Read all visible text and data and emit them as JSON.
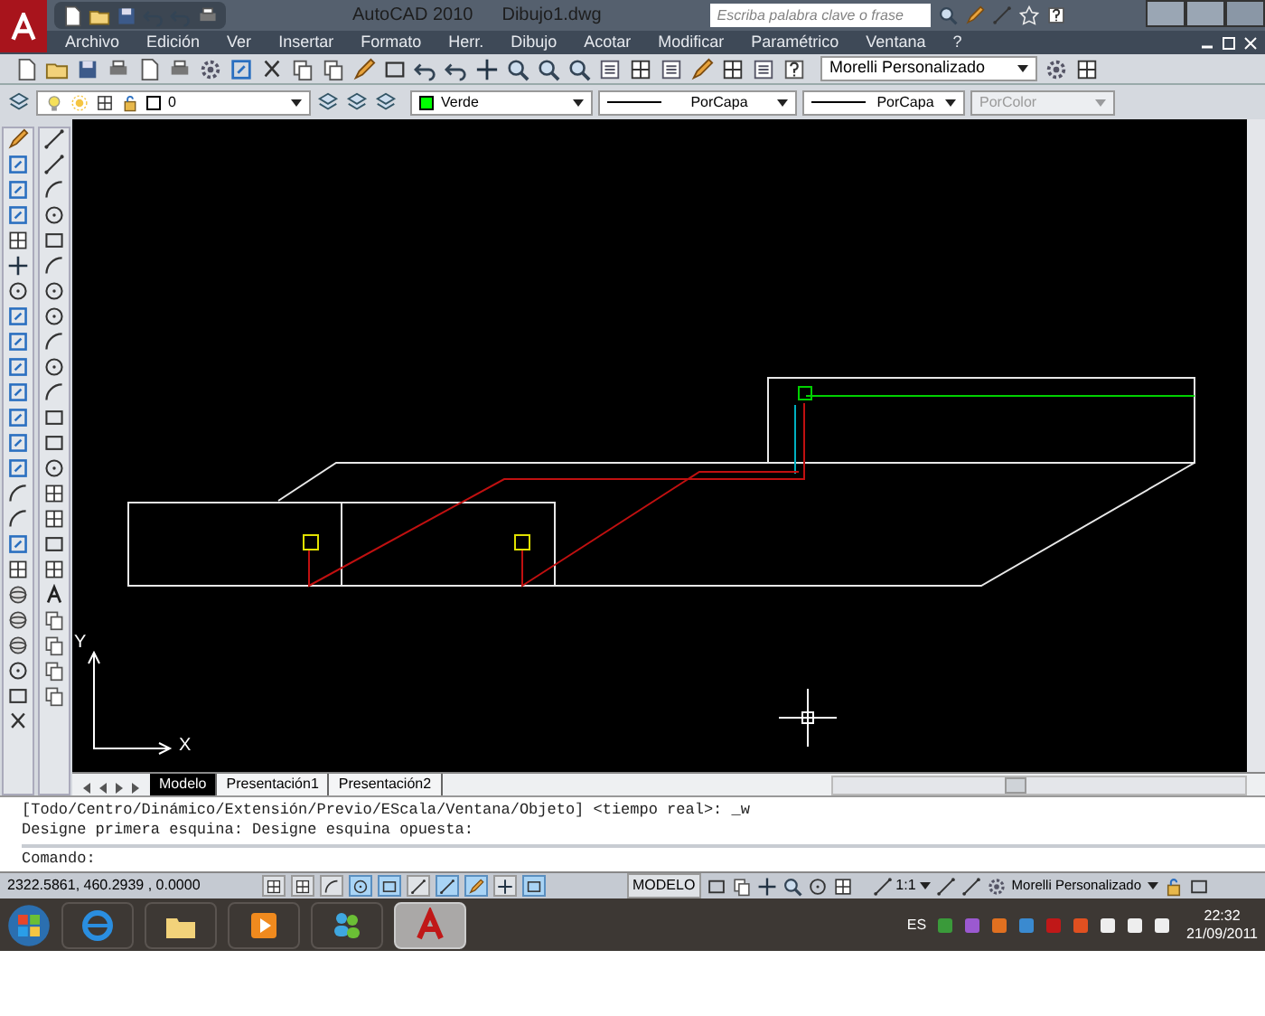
{
  "title_bar": {
    "app": "AutoCAD 2010",
    "document": "Dibujo1.dwg",
    "search": {
      "placeholder": "Escriba palabra clave o frase"
    }
  },
  "menu_bar": {
    "items": [
      "Archivo",
      "Edición",
      "Ver",
      "Insertar",
      "Formato",
      "Herr.",
      "Dibujo",
      "Acotar",
      "Modificar",
      "Paramétrico",
      "Ventana",
      "?"
    ]
  },
  "standard_toolbar": {
    "workspace": "Morelli Personalizado"
  },
  "properties_toolbar": {
    "layer": "0",
    "color": {
      "label": "Verde",
      "color": "#00ff00"
    },
    "linetype": "PorCapa",
    "lineweight": "PorCapa",
    "plot_style": {
      "label": "PorColor",
      "disabled": true
    }
  },
  "drawing": {
    "ucs_y": "Y",
    "ucs_x": "X"
  },
  "layout_tabs": [
    {
      "label": "Modelo",
      "selected": true
    },
    {
      "label": "Presentación1",
      "selected": false
    },
    {
      "label": "Presentación2",
      "selected": false
    }
  ],
  "command_window": {
    "history": [
      "[Todo/Centro/Dinámico/Extensión/Previo/EScala/Ventana/Objeto] <tiempo real>: _w",
      "Designe primera esquina: Designe esquina opuesta:"
    ],
    "prompt": "Comando:"
  },
  "status_bar": {
    "coordinates": "2322.5861, 460.2939 , 0.0000",
    "toggles": [
      {
        "on": false
      },
      {
        "on": false
      },
      {
        "on": false
      },
      {
        "on": true
      },
      {
        "on": true
      },
      {
        "on": false
      },
      {
        "on": true
      },
      {
        "on": true
      },
      {
        "on": false
      },
      {
        "on": true
      }
    ],
    "space": "MODELO",
    "annotation_scale": "1:1",
    "workspace": "Morelli Personalizado"
  },
  "taskbar": {
    "apps": [
      {
        "selected": false
      },
      {
        "selected": false
      },
      {
        "selected": false
      },
      {
        "selected": false
      },
      {
        "selected": true
      }
    ],
    "language": "ES",
    "time": "22:32",
    "date": "21/09/2011"
  }
}
